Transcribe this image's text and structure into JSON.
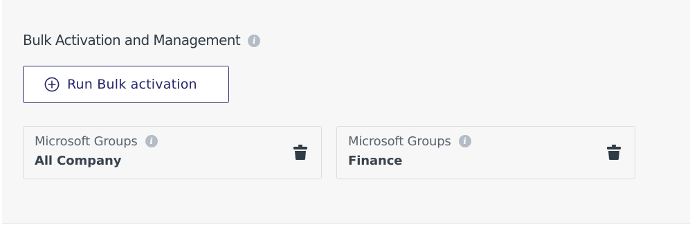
{
  "section": {
    "title": "Bulk Activation and Management",
    "info_icon": "info-icon"
  },
  "run_button": {
    "label": "Run Bulk activation",
    "icon": "plus-circle-icon"
  },
  "groups": [
    {
      "type_label": "Microsoft Groups",
      "name": "All Company",
      "info_icon": "info-icon",
      "action_icon": "trash-icon"
    },
    {
      "type_label": "Microsoft Groups",
      "name": "Finance",
      "info_icon": "info-icon",
      "action_icon": "trash-icon"
    }
  ],
  "colors": {
    "panel_background": "#f7f7f7",
    "button_border": "#2b2d6e",
    "button_text": "#24266a",
    "title_text": "#2f3b45",
    "info_icon": "#b4bcc6",
    "trash_icon": "#2f3b45"
  }
}
